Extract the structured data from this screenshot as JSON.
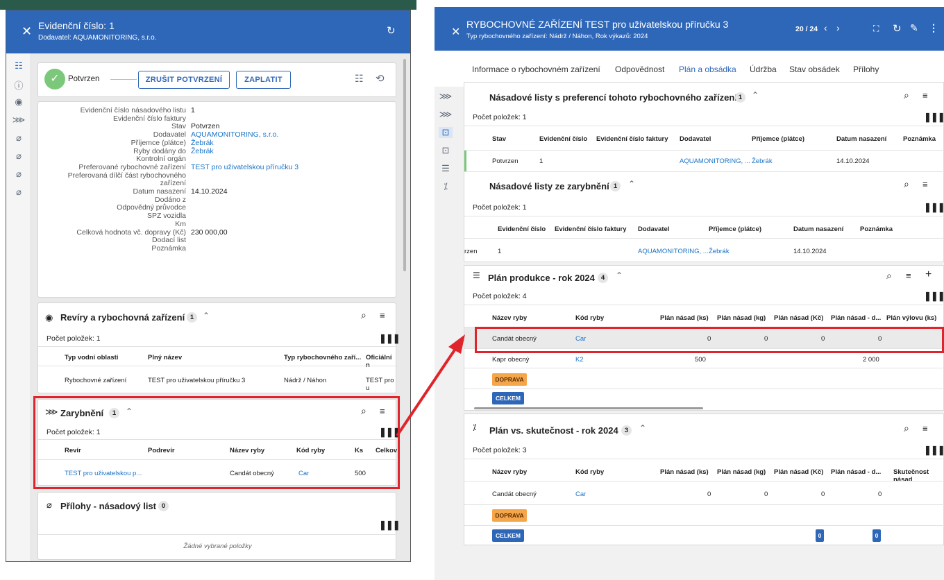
{
  "left": {
    "title": "Evidenční číslo: 1",
    "subtitle": "Dodavatel: AQUAMONITORING, s.r.o.",
    "status": "Potvrzen",
    "cancel_btn": "ZRUŠIT POTVRZENÍ",
    "pay_btn": "ZAPLATIT",
    "fields": [
      {
        "k": "Evidenční číslo násadového listu",
        "v": "1",
        "link": false
      },
      {
        "k": "Evidenční číslo faktury",
        "v": "",
        "link": false
      },
      {
        "k": "Stav",
        "v": "Potvrzen",
        "link": false
      },
      {
        "k": "Dodavatel",
        "v": "AQUAMONITORING, s.r.o.",
        "link": true
      },
      {
        "k": "Příjemce (plátce)",
        "v": "Žebrák",
        "link": true
      },
      {
        "k": "Ryby dodány do",
        "v": "Žebrák",
        "link": true
      },
      {
        "k": "Kontrolní orgán",
        "v": "",
        "link": false
      },
      {
        "k": "Preferované rybochovné zařízení",
        "v": "TEST pro uživatelskou příručku 3",
        "link": true
      },
      {
        "k": "Preferovaná dílčí část rybochovného",
        "v": "",
        "link": false
      },
      {
        "k": "zařízení",
        "v": "",
        "link": false
      },
      {
        "k": "Datum nasazení",
        "v": "14.10.2024",
        "link": false
      },
      {
        "k": "Dodáno z",
        "v": "",
        "link": false
      },
      {
        "k": "Odpovědný průvodce",
        "v": "",
        "link": false
      },
      {
        "k": "SPZ vozidla",
        "v": "",
        "link": false
      },
      {
        "k": "Km",
        "v": "",
        "link": false
      },
      {
        "k": "Celková hodnota vč. dopravy (Kč)",
        "v": "230 000,00",
        "link": false
      },
      {
        "k": "Dodací list",
        "v": "",
        "link": false
      },
      {
        "k": "Poznámka",
        "v": "",
        "link": false
      }
    ],
    "revir": {
      "title": "Revíry a rybochovná zařízení",
      "count": "1",
      "items": "Počet položek: 1",
      "headers": [
        "Typ vodní oblasti",
        "Plný název",
        "Typ rybochovného zaří...",
        "Oficiální n"
      ],
      "row": [
        "Rybochovné zařízení",
        "TEST pro uživatelskou příručku 3",
        "Nádrž / Náhon",
        "TEST pro u"
      ]
    },
    "zaryb": {
      "title": "Zarybnění",
      "count": "1",
      "items": "Počet položek: 1",
      "headers": [
        "Revír",
        "Podrevír",
        "Název ryby",
        "Kód ryby",
        "Ks",
        "Celkov"
      ],
      "row": [
        "TEST pro uživatelskou p...",
        "",
        "Candát obecný",
        "Car",
        "500",
        ""
      ]
    },
    "prilohy": {
      "title": "Přílohy - násadový list",
      "count": "0",
      "empty": "Žádné vybrané položky"
    }
  },
  "right": {
    "title": "RYBOCHOVNÉ ZAŘÍZENÍ TEST pro uživatelskou příručku 3",
    "subtitle": "Typ rybochovného zařízení: Nádrž / Náhon, Rok výkazů: 2024",
    "pager": "20 / 24",
    "tabs": [
      "Informace o rybochovném zařízení",
      "Odpovědnost",
      "Plán a obsádka",
      "Údržba",
      "Stav obsádek",
      "Přílohy"
    ],
    "active_tab": "Plán a obsádka",
    "pref": {
      "title": "Násadové listy s preferencí tohoto rybochovného zařízení",
      "count": "1",
      "items": "Počet položek: 1",
      "headers": [
        "Stav",
        "Evidenční číslo",
        "Evidenční číslo faktury",
        "Dodavatel",
        "Příjemce (plátce)",
        "Datum nasazení",
        "Poznámka"
      ],
      "row": [
        "Potvrzen",
        "1",
        "",
        "AQUAMONITORING, ...",
        "Žebrák",
        "14.10.2024",
        ""
      ]
    },
    "zaryb": {
      "title": "Násadové listy ze zarybnění",
      "count": "1",
      "items": "Počet položek: 1",
      "headers": [
        "Evidenční číslo",
        "Evidenční číslo faktury",
        "Dodavatel",
        "Příjemce (plátce)",
        "Datum nasazení",
        "Poznámka"
      ],
      "row": [
        "rzen",
        "1",
        "",
        "AQUAMONITORING, ...",
        "Žebrák",
        "14.10.2024",
        ""
      ]
    },
    "plan": {
      "title": "Plán produkce - rok 2024",
      "count": "4",
      "items": "Počet položek: 4",
      "headers": [
        "Název ryby",
        "Kód ryby",
        "Plán násad (ks)",
        "Plán násad (kg)",
        "Plán násad (Kč)",
        "Plán násad - d...",
        "Plán výlovu (ks)"
      ],
      "rows": [
        [
          "Candát obecný",
          "Car",
          "0",
          "0",
          "0",
          "0",
          ""
        ],
        [
          "Kapr obecný",
          "K2",
          "500",
          "",
          "",
          "2 000",
          ""
        ]
      ],
      "doprava": "DOPRAVA",
      "celkem": "CELKEM"
    },
    "vs": {
      "title": "Plán vs. skutečnost - rok 2024",
      "count": "3",
      "items": "Počet položek: 3",
      "headers": [
        "Název ryby",
        "Kód ryby",
        "Plán násad (ks)",
        "Plán násad (kg)",
        "Plán násad (Kč)",
        "Plán násad - d...",
        "Skutečnost násad"
      ],
      "row": [
        "Candát obecný",
        "Car",
        "0",
        "0",
        "0",
        "0",
        ""
      ],
      "doprava": "DOPRAVA",
      "celkem": "CELKEM",
      "celkem_a": "0",
      "celkem_b": "0"
    }
  },
  "colors": {
    "header": "#2f67b8",
    "link": "#1a73c7",
    "highlight": "#e0242b",
    "confirmed": "#7cc87a",
    "doprava": "#f5a54a"
  }
}
